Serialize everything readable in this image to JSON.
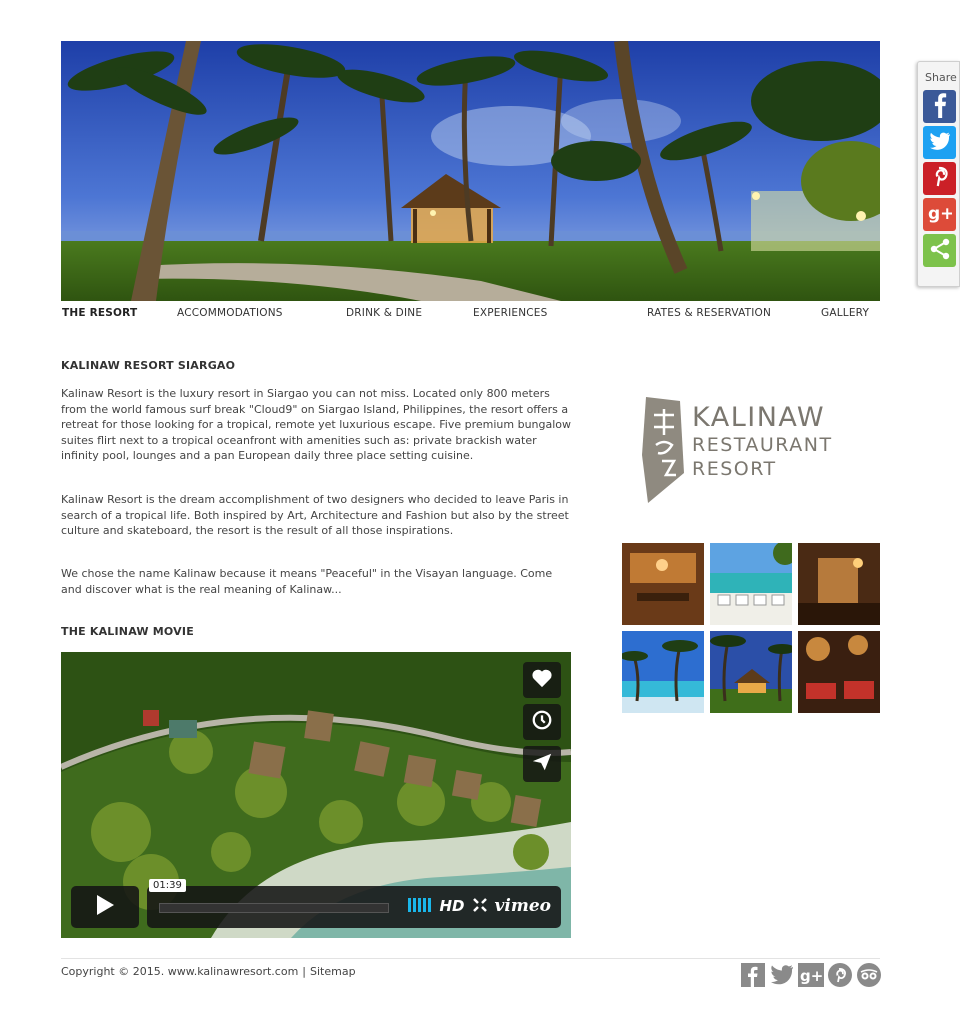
{
  "nav": {
    "items": [
      {
        "label": "THE RESORT",
        "active": true
      },
      {
        "label": "ACCOMMODATIONS",
        "active": false
      },
      {
        "label": "DRINK & DINE",
        "active": false
      },
      {
        "label": "EXPERIENCES",
        "active": false
      },
      {
        "label": "RATES & RESERVATION",
        "active": false
      },
      {
        "label": "GALLERY",
        "active": false
      }
    ]
  },
  "main": {
    "heading": "KALINAW RESORT SIARGAO",
    "paragraphs": [
      "Kalinaw Resort is the luxury resort in Siargao you can not miss. Located only 800 meters from the world famous surf break \"Cloud9\" on Siargao Island, Philippines, the resort offers a retreat for those looking for a tropical, remote yet luxurious escape. Five premium bungalow suites flirt next to a tropical oceanfront with amenities such as: private brackish water infinity pool, lounges and a pan European daily three place setting cuisine.",
      "Kalinaw Resort is the dream accomplishment of two designers who decided to leave Paris in search of a tropical life. Both inspired by Art, Architecture and Fashion but also by the street culture and skateboard, the resort is the result of all those inspirations.",
      "We chose the name Kalinaw because it means \"Peaceful\" in the Visayan language. Come and discover what is the real meaning of Kalinaw..."
    ],
    "movie_heading": "THE KALINAW MOVIE"
  },
  "video": {
    "time": "01:39",
    "hd_label": "HD",
    "brand": "vimeo",
    "icons": [
      "heart-icon",
      "clock-icon",
      "send-icon",
      "play-icon",
      "volume-icon",
      "fullscreen-icon"
    ]
  },
  "logo": {
    "line1": "KALINAW",
    "line2": "RESTAURANT",
    "line3": "RESORT"
  },
  "footer": {
    "copyright": "Copyright © 2015. www.kalinawresort.com",
    "separator": "|",
    "sitemap": "Sitemap",
    "social_icons": [
      "facebook-icon",
      "twitter-icon",
      "google-plus-icon",
      "pinterest-icon",
      "tripadvisor-icon"
    ]
  },
  "share": {
    "label": "Share",
    "buttons": [
      {
        "name": "facebook",
        "color": "#3b5998"
      },
      {
        "name": "twitter",
        "color": "#1da1f2"
      },
      {
        "name": "pinterest",
        "color": "#cb2027"
      },
      {
        "name": "google-plus",
        "color": "#dd4b39"
      },
      {
        "name": "share",
        "color": "#7dc24b"
      }
    ]
  },
  "colors": {
    "nav_text": "#333333",
    "footer_icons": "#8a8a8a",
    "logo_gray": "#7b776f"
  }
}
